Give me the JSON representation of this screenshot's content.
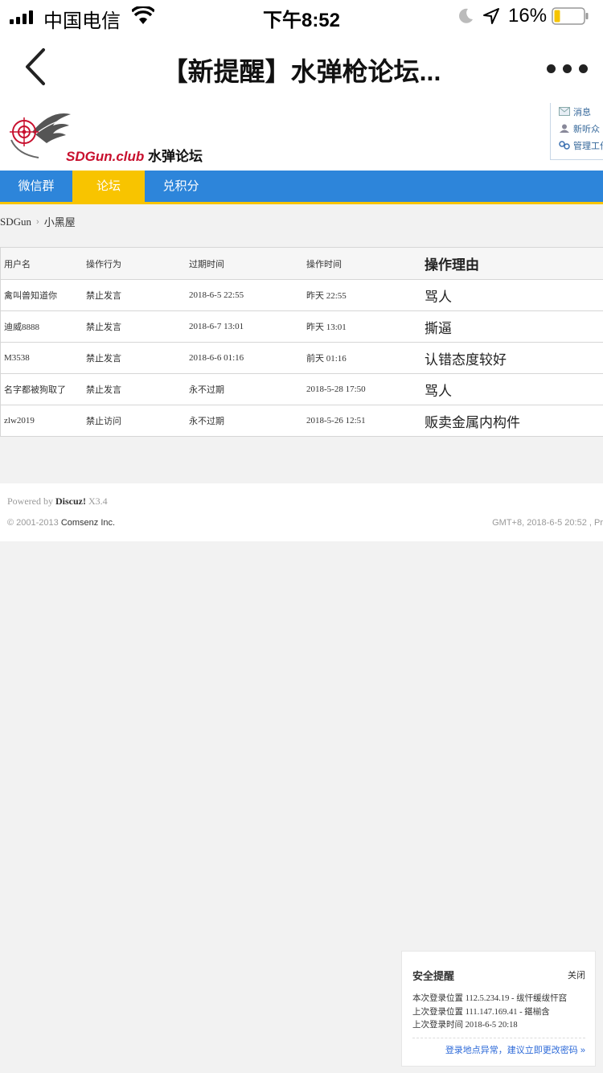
{
  "status_bar": {
    "carrier": "中国电信",
    "time": "下午8:52",
    "battery": "16%"
  },
  "nav": {
    "title": "【新提醒】水弹枪论坛..."
  },
  "forum_header": {
    "logo_text_red": "SDGun.club",
    "logo_text_black": "水弹论坛",
    "user_links": [
      "消息",
      "新听众",
      "管理工作"
    ]
  },
  "tabs": [
    {
      "label": "微信群",
      "active": false
    },
    {
      "label": "论坛",
      "active": true
    },
    {
      "label": "兑积分",
      "active": false
    }
  ],
  "breadcrumb": {
    "home": "SDGun",
    "current": "小黑屋"
  },
  "table": {
    "headers": [
      "用户名",
      "操作行为",
      "过期时间",
      "操作时间",
      "操作理由"
    ],
    "rows": [
      [
        "禽叫兽知道你",
        "禁止发言",
        "2018-6-5 22:55",
        "昨天 22:55",
        "骂人"
      ],
      [
        "迪威8888",
        "禁止发言",
        "2018-6-7 13:01",
        "昨天 13:01",
        "撕逼"
      ],
      [
        "M3538",
        "禁止发言",
        "2018-6-6 01:16",
        "前天 01:16",
        "认错态度较好"
      ],
      [
        "名字都被狗取了",
        "禁止发言",
        "永不过期",
        "2018-5-28 17:50",
        "骂人"
      ],
      [
        "zlw2019",
        "禁止访问",
        "永不过期",
        "2018-5-26 12:51",
        "贩卖金属内构件"
      ]
    ]
  },
  "footer": {
    "powered_prefix": "Powered by",
    "powered_brand": "Discuz!",
    "powered_version": "X3.4",
    "copyright_prefix": "© 2001-2013",
    "copyright_company": "Comsenz Inc.",
    "gmt": "GMT+8, 2018-6-5 20:52 , Pr"
  },
  "notice": {
    "title": "安全提醒",
    "close": "关闭",
    "lines": [
      "本次登录位置 112.5.234.19 - 绂忓缓绂忓窞",
      "上次登录位置 111.147.169.41 - 鍖椾含",
      "上次登录时间 2018-6-5 20:18"
    ],
    "link": "登录地点异常，建议立即更改密码 »"
  },
  "colors": {
    "tab_bar": "#2d85da",
    "tab_active": "#f8c400",
    "link_blue": "#2d6ad8",
    "logo_red": "#c8102e"
  }
}
